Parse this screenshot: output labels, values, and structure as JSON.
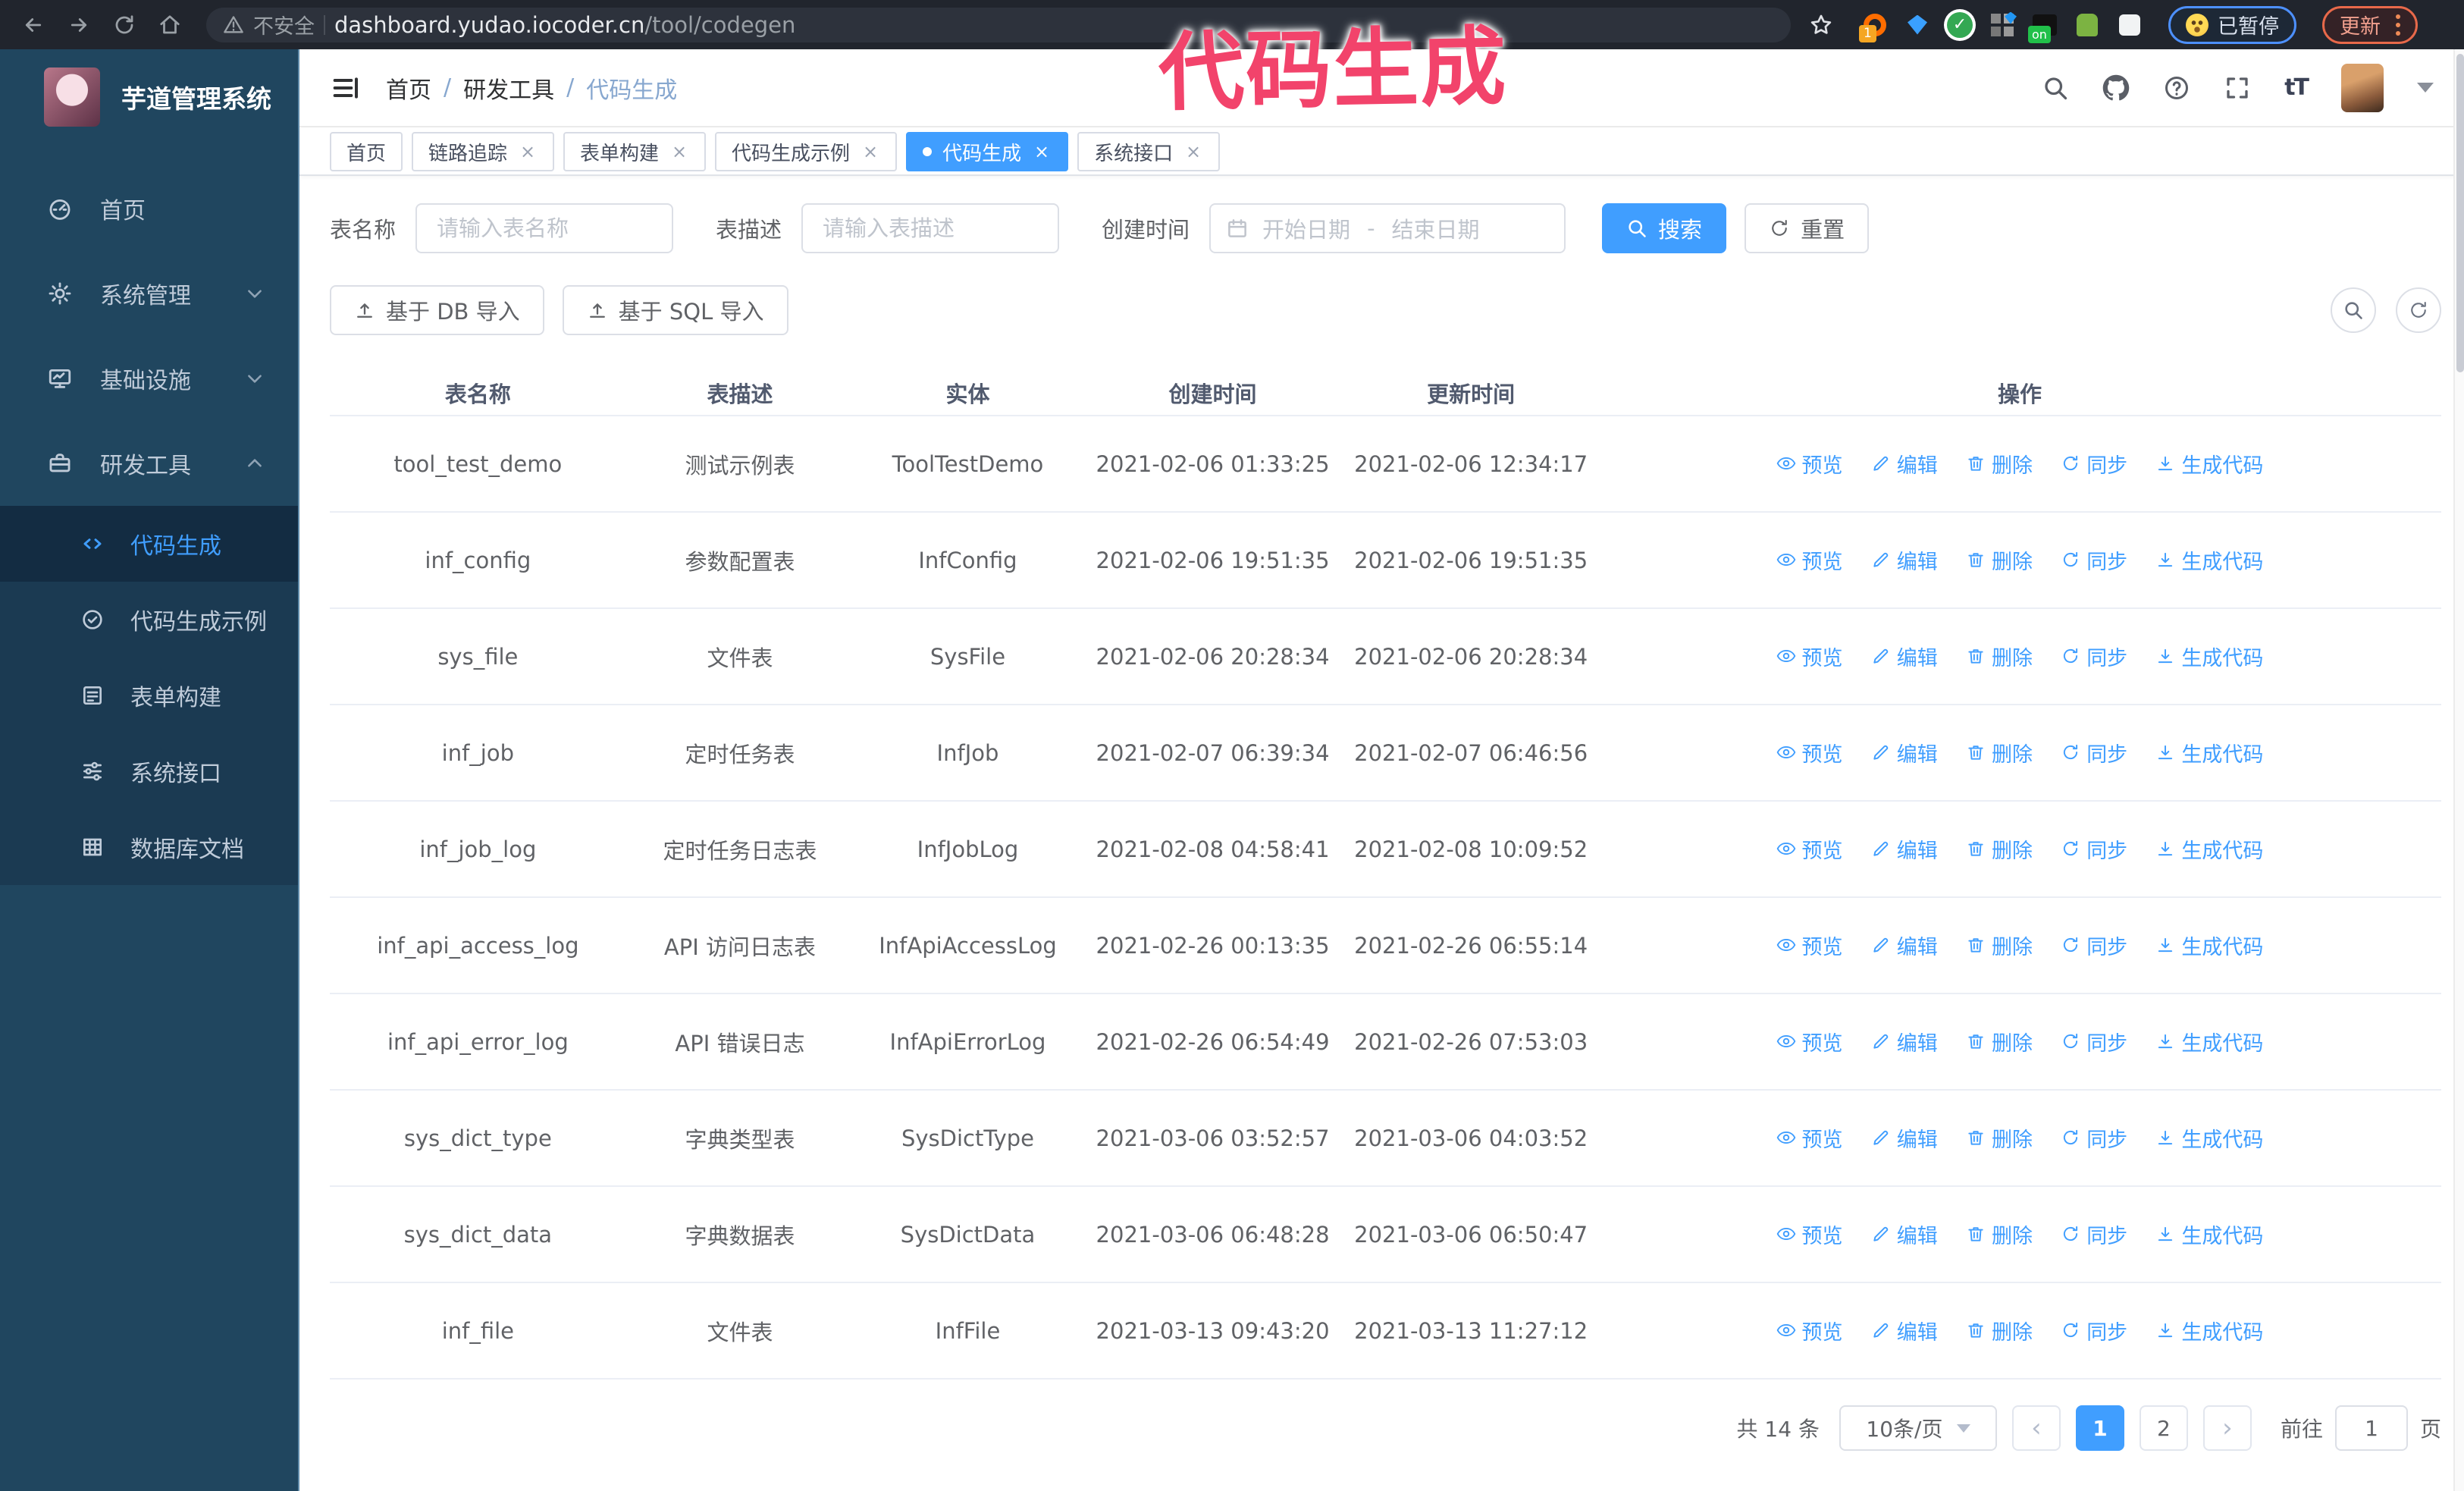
{
  "browser": {
    "insecure_label": "不安全",
    "url_host": "dashboard.yudao.iocoder.cn",
    "url_path": "/tool/codegen",
    "paused_label": "已暂停",
    "update_label": "更新"
  },
  "annotation": {
    "text": "代码生成",
    "color": "#f2436b"
  },
  "sidebar": {
    "title": "芋道管理系统",
    "items": [
      {
        "label": "首页",
        "icon": "dashboard-icon"
      },
      {
        "label": "系统管理",
        "icon": "gear-icon"
      },
      {
        "label": "基础设施",
        "icon": "monitor-icon"
      },
      {
        "label": "研发工具",
        "icon": "toolbox-icon"
      }
    ],
    "submenu": [
      {
        "label": "代码生成",
        "icon": "code-icon",
        "active": true
      },
      {
        "label": "代码生成示例",
        "icon": "badge-check-icon"
      },
      {
        "label": "表单构建",
        "icon": "form-icon"
      },
      {
        "label": "系统接口",
        "icon": "sliders-icon"
      },
      {
        "label": "数据库文档",
        "icon": "table-grid-icon"
      }
    ]
  },
  "breadcrumb": [
    "首页",
    "研发工具",
    "代码生成"
  ],
  "tabs": [
    {
      "label": "首页"
    },
    {
      "label": "链路追踪"
    },
    {
      "label": "表单构建"
    },
    {
      "label": "代码生成示例"
    },
    {
      "label": "代码生成"
    },
    {
      "label": "系统接口"
    }
  ],
  "filters": {
    "table_name_label": "表名称",
    "table_name_placeholder": "请输入表名称",
    "table_desc_label": "表描述",
    "table_desc_placeholder": "请输入表描述",
    "create_time_label": "创建时间",
    "date_start_placeholder": "开始日期",
    "date_separator": "-",
    "date_end_placeholder": "结束日期",
    "search_label": "搜索",
    "reset_label": "重置"
  },
  "toolbar": {
    "import_db_label": "基于 DB 导入",
    "import_sql_label": "基于 SQL 导入"
  },
  "table": {
    "columns": [
      "表名称",
      "表描述",
      "实体",
      "创建时间",
      "更新时间",
      "操作"
    ],
    "actions": [
      "预览",
      "编辑",
      "删除",
      "同步",
      "生成代码"
    ],
    "rows": [
      {
        "name": "tool_test_demo",
        "desc": "测试示例表",
        "entity": "ToolTestDemo",
        "created": "2021-02-06 01:33:25",
        "updated": "2021-02-06 12:34:17"
      },
      {
        "name": "inf_config",
        "desc": "参数配置表",
        "entity": "InfConfig",
        "created": "2021-02-06 19:51:35",
        "updated": "2021-02-06 19:51:35"
      },
      {
        "name": "sys_file",
        "desc": "文件表",
        "entity": "SysFile",
        "created": "2021-02-06 20:28:34",
        "updated": "2021-02-06 20:28:34"
      },
      {
        "name": "inf_job",
        "desc": "定时任务表",
        "entity": "InfJob",
        "created": "2021-02-07 06:39:34",
        "updated": "2021-02-07 06:46:56"
      },
      {
        "name": "inf_job_log",
        "desc": "定时任务日志表",
        "entity": "InfJobLog",
        "created": "2021-02-08 04:58:41",
        "updated": "2021-02-08 10:09:52"
      },
      {
        "name": "inf_api_access_log",
        "desc": "API 访问日志表",
        "entity": "InfApiAccessLog",
        "created": "2021-02-26 00:13:35",
        "updated": "2021-02-26 06:55:14"
      },
      {
        "name": "inf_api_error_log",
        "desc": "API 错误日志",
        "entity": "InfApiErrorLog",
        "created": "2021-02-26 06:54:49",
        "updated": "2021-02-26 07:53:03"
      },
      {
        "name": "sys_dict_type",
        "desc": "字典类型表",
        "entity": "SysDictType",
        "created": "2021-03-06 03:52:57",
        "updated": "2021-03-06 04:03:52"
      },
      {
        "name": "sys_dict_data",
        "desc": "字典数据表",
        "entity": "SysDictData",
        "created": "2021-03-06 06:48:28",
        "updated": "2021-03-06 06:50:47"
      },
      {
        "name": "inf_file",
        "desc": "文件表",
        "entity": "InfFile",
        "created": "2021-03-13 09:43:20",
        "updated": "2021-03-13 11:27:12"
      }
    ]
  },
  "pagination": {
    "total_label": "共 14 条",
    "page_size_label": "10条/页",
    "pages": [
      "1",
      "2"
    ],
    "active_page": "1",
    "goto_label": "前往",
    "goto_value": "1",
    "goto_suffix": "页"
  }
}
